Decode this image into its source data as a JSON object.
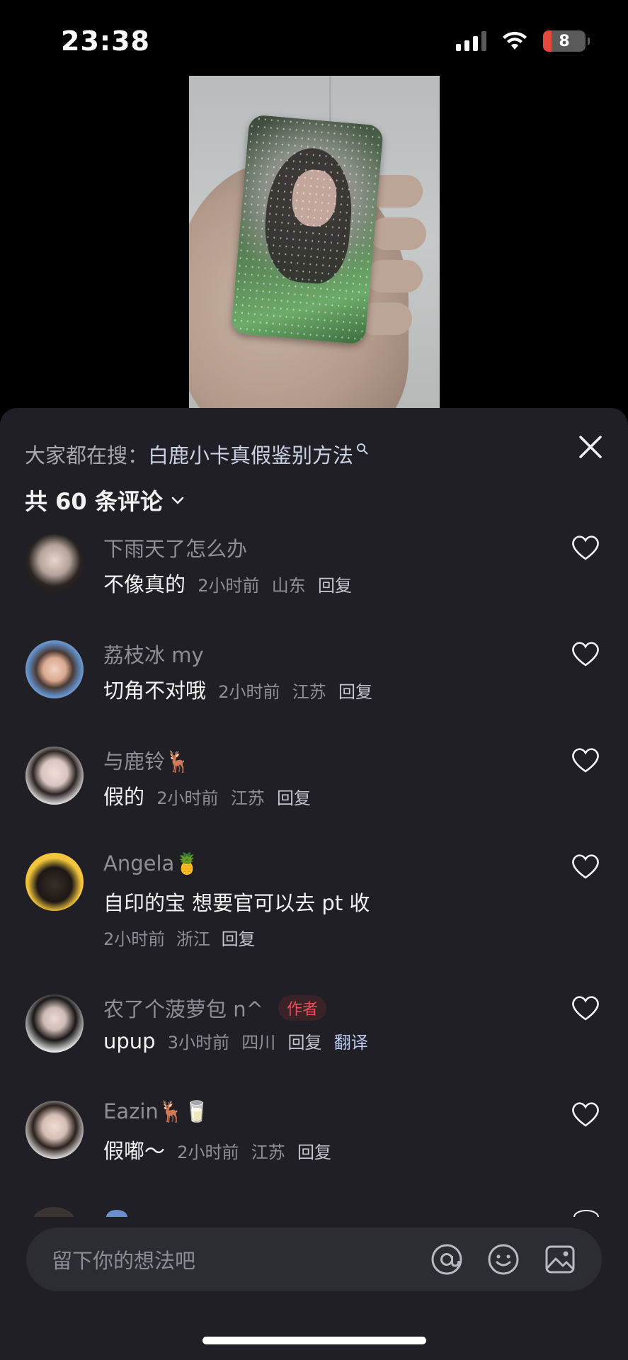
{
  "status_bar": {
    "time": "23:38",
    "battery": "8"
  },
  "sheet": {
    "search_prefix": "大家都在搜：",
    "search_term": "白鹿小卡真假鉴别方法",
    "comment_count_label": "共 60 条评论"
  },
  "comments": [
    {
      "name": "下雨天了怎么办",
      "text": "不像真的",
      "time": "2小时前",
      "location": "山东",
      "reply": "回复"
    },
    {
      "name": "荔枝冰 my",
      "text": "切角不对哦",
      "time": "2小时前",
      "location": "江苏",
      "reply": "回复"
    },
    {
      "name": "与鹿铃🦌",
      "text": "假的",
      "time": "2小时前",
      "location": "江苏",
      "reply": "回复"
    },
    {
      "name": "Angela🍍",
      "text": "自印的宝 想要官可以去 pt 收",
      "time": "2小时前",
      "location": "浙江",
      "reply": "回复"
    },
    {
      "name": "农了个菠萝包 n^",
      "badge": "作者",
      "text": "upup",
      "time": "3小时前",
      "location": "四川",
      "reply": "回复",
      "translate": "翻译"
    },
    {
      "name": "Eazin🦌🥛",
      "text": "假嘟～",
      "time": "2小时前",
      "location": "江苏",
      "reply": "回复"
    }
  ],
  "input": {
    "placeholder": "留下你的想法吧"
  },
  "colors": {
    "sheet_bg": "#1f1f25",
    "author_badge": "#f04b5a",
    "translate_link": "#b8c9ef"
  }
}
